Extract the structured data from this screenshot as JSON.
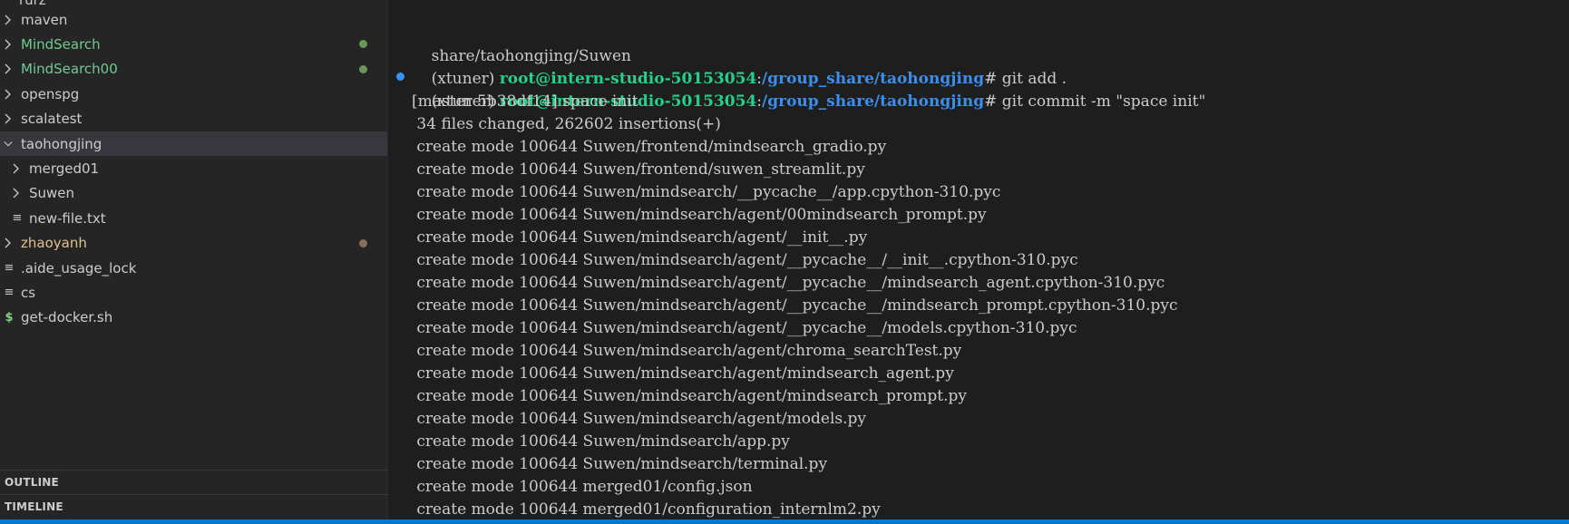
{
  "colors": {
    "status_bar": "#007acc",
    "git_modified_dot": "#8fbf8f",
    "git_untracked_dot": "#a08070",
    "green_folder_text": "#73c991",
    "orange_folder_text": "#e2c08d",
    "shell_icon": "#89d185",
    "gutter_dot": "#3794ff"
  },
  "sidebar": {
    "partial_top_label": "rurz",
    "items": [
      {
        "label": "maven",
        "kind": "folder-collapsed",
        "color": "#cccccc",
        "dot": null,
        "chevron": "chevron-right-icon"
      },
      {
        "label": "MindSearch",
        "kind": "folder-collapsed",
        "color": "#73c991",
        "dot": "#6a9955",
        "chevron": "chevron-right-icon"
      },
      {
        "label": "MindSearch00",
        "kind": "folder-collapsed",
        "color": "#73c991",
        "dot": "#6a9955",
        "chevron": "chevron-right-icon"
      },
      {
        "label": "openspg",
        "kind": "folder-collapsed",
        "color": "#cccccc",
        "dot": null,
        "chevron": "chevron-right-icon"
      },
      {
        "label": "scalatest",
        "kind": "folder-collapsed",
        "color": "#cccccc",
        "dot": null,
        "chevron": "chevron-right-icon"
      },
      {
        "label": "taohongjing",
        "kind": "folder-expanded",
        "color": "#cccccc",
        "dot": null,
        "chevron": "chevron-down-icon"
      },
      {
        "label": "merged01",
        "kind": "subfolder-collapsed",
        "color": "#cccccc",
        "dot": null,
        "chevron": "chevron-right-icon"
      },
      {
        "label": "Suwen",
        "kind": "subfolder-collapsed",
        "color": "#cccccc",
        "dot": null,
        "chevron": "chevron-right-icon"
      },
      {
        "label": "new-file.txt",
        "kind": "subfile-text",
        "color": "#cccccc",
        "dot": null,
        "chevron": null
      },
      {
        "label": "zhaoyanh",
        "kind": "folder-collapsed",
        "color": "#e2c08d",
        "dot": "#8a6e5b",
        "chevron": "chevron-right-icon"
      },
      {
        "label": ".aide_usage_lock",
        "kind": "file-text",
        "color": "#cccccc",
        "dot": null,
        "chevron": null
      },
      {
        "label": "cs",
        "kind": "file-text",
        "color": "#cccccc",
        "dot": null,
        "chevron": null
      },
      {
        "label": "get-docker.sh",
        "kind": "file-shell",
        "color": "#cccccc",
        "dot": null,
        "chevron": null
      }
    ],
    "outline_label": "OUTLINE",
    "timeline_label": "TIMELINE"
  },
  "terminal": {
    "line0": "share/taohongjing/Suwen",
    "prompt1": {
      "env": "(xtuner) ",
      "userhost": "root@intern-studio-50153054",
      "sep": ":",
      "path": "/group_share/taohongjing",
      "sym": "# ",
      "cmd": "git add ."
    },
    "prompt2": {
      "env": "(xtuner) ",
      "userhost": "root@intern-studio-50153054",
      "sep": ":",
      "path": "/group_share/taohongjing",
      "sym": "# ",
      "cmd": "git commit -m \"space init\""
    },
    "output": [
      "[master 5b38df14] space init",
      " 34 files changed, 262602 insertions(+)",
      " create mode 100644 Suwen/frontend/mindsearch_gradio.py",
      " create mode 100644 Suwen/frontend/suwen_streamlit.py",
      " create mode 100644 Suwen/mindsearch/__pycache__/app.cpython-310.pyc",
      " create mode 100644 Suwen/mindsearch/agent/00mindsearch_prompt.py",
      " create mode 100644 Suwen/mindsearch/agent/__init__.py",
      " create mode 100644 Suwen/mindsearch/agent/__pycache__/__init__.cpython-310.pyc",
      " create mode 100644 Suwen/mindsearch/agent/__pycache__/mindsearch_agent.cpython-310.pyc",
      " create mode 100644 Suwen/mindsearch/agent/__pycache__/mindsearch_prompt.cpython-310.pyc",
      " create mode 100644 Suwen/mindsearch/agent/__pycache__/models.cpython-310.pyc",
      " create mode 100644 Suwen/mindsearch/agent/chroma_searchTest.py",
      " create mode 100644 Suwen/mindsearch/agent/mindsearch_agent.py",
      " create mode 100644 Suwen/mindsearch/agent/mindsearch_prompt.py",
      " create mode 100644 Suwen/mindsearch/agent/models.py",
      " create mode 100644 Suwen/mindsearch/app.py",
      " create mode 100644 Suwen/mindsearch/terminal.py",
      " create mode 100644 merged01/config.json",
      " create mode 100644 merged01/configuration_internlm2.py"
    ]
  }
}
